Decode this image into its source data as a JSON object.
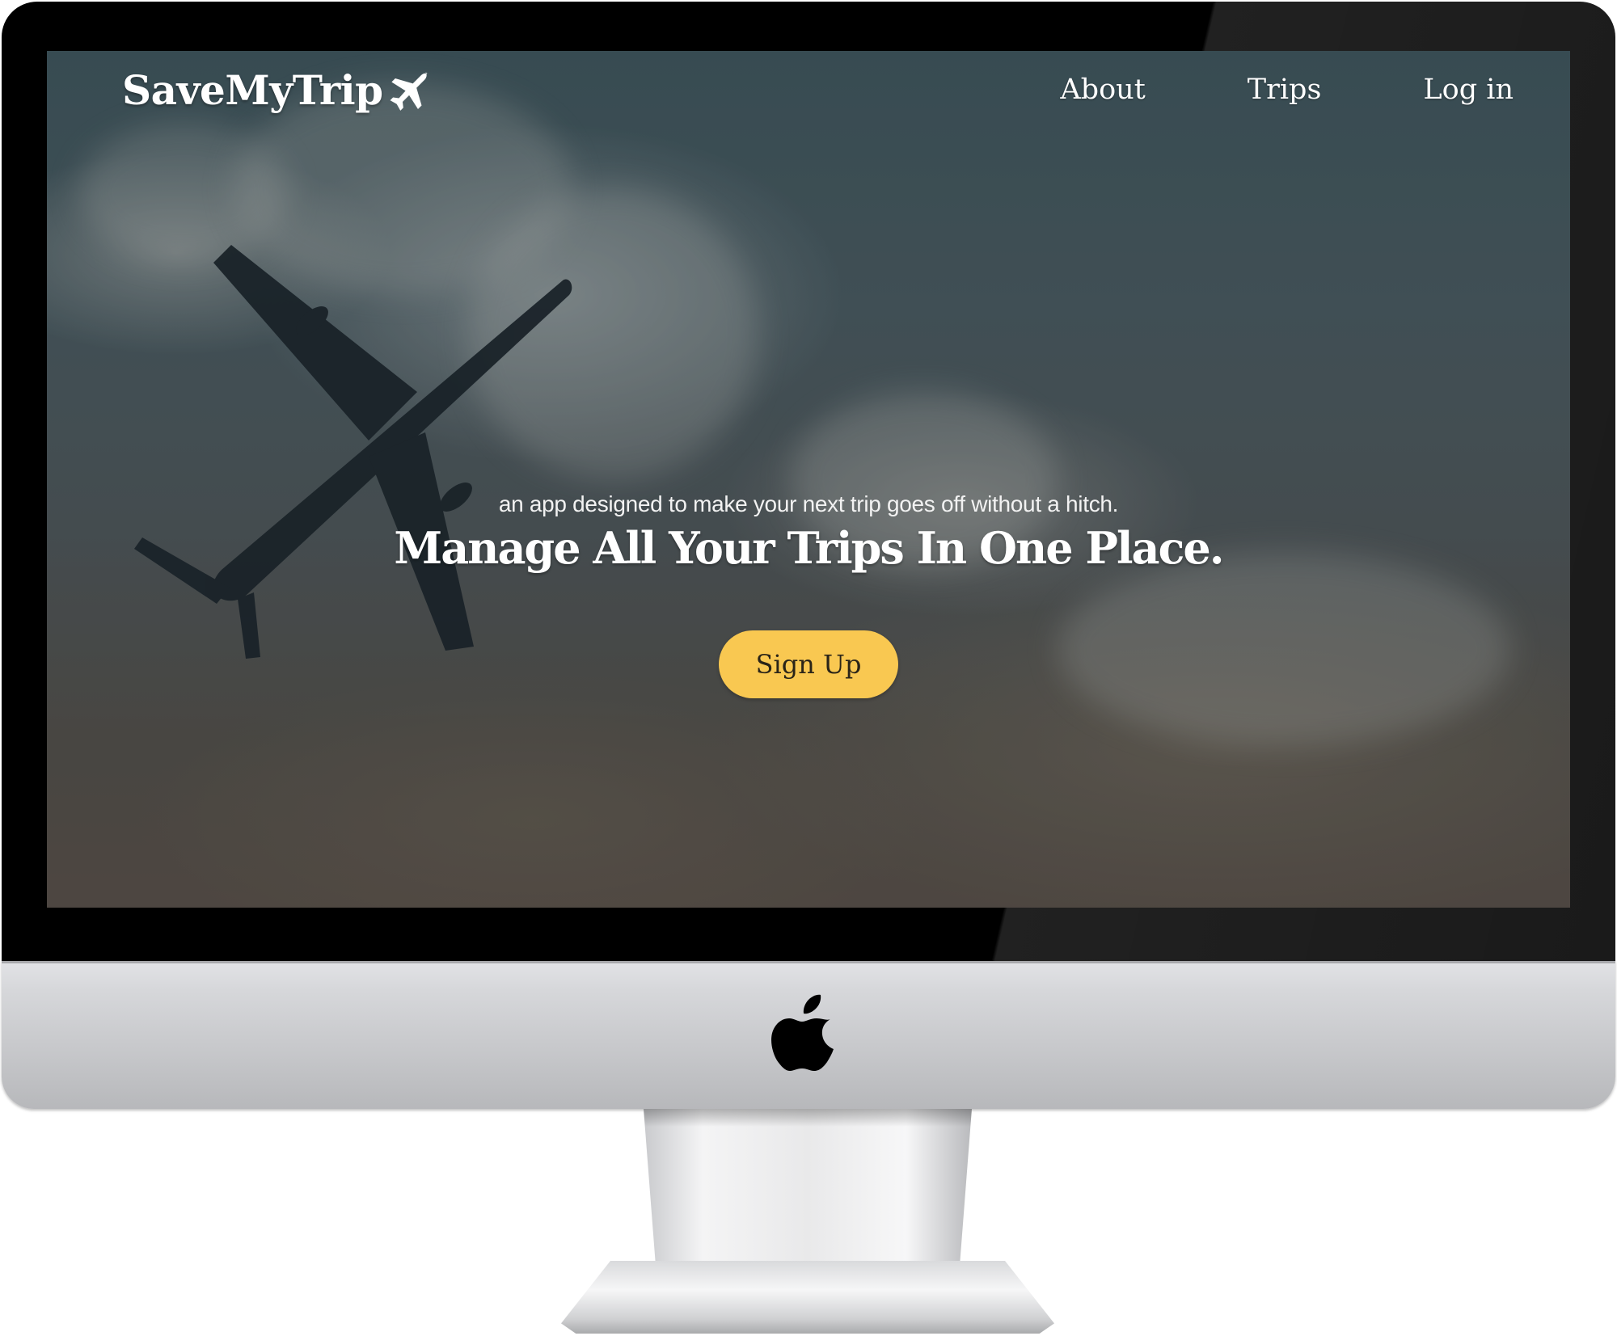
{
  "site": {
    "brand": "SaveMyTrip",
    "brand_icon": "airplane-icon",
    "nav": [
      {
        "label": "About"
      },
      {
        "label": "Trips"
      },
      {
        "label": "Log in"
      }
    ]
  },
  "hero": {
    "tagline": "an app designed to make your next trip goes off without a hitch.",
    "headline": "Manage All Your Trips In One Place.",
    "cta_label": "Sign Up"
  },
  "colors": {
    "accent": "#f9c851",
    "nav_text": "#ffffff"
  },
  "device": {
    "logo_icon": "apple-logo-icon"
  }
}
